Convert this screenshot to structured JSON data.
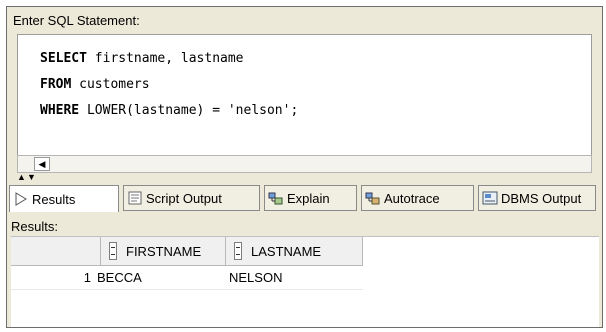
{
  "prompt_label": "Enter SQL Statement:",
  "sql": {
    "line1": {
      "keyword": "SELECT",
      "rest": " firstname, lastname"
    },
    "line2": {
      "keyword": "FROM",
      "rest": " customers"
    },
    "line3": {
      "keyword": "WHERE",
      "rest": " LOWER(lastname) = 'nelson';"
    }
  },
  "tabs": [
    {
      "label": "Results",
      "icon": "play-arrow-icon",
      "active": true
    },
    {
      "label": "Script Output",
      "icon": "script-document-icon"
    },
    {
      "label": "Explain",
      "icon": "explain-plan-icon"
    },
    {
      "label": "Autotrace",
      "icon": "autotrace-icon"
    },
    {
      "label": "DBMS Output",
      "icon": "dbms-output-icon"
    }
  ],
  "results_label": "Results:",
  "grid": {
    "columns": [
      "FIRSTNAME",
      "LASTNAME"
    ],
    "rows": [
      {
        "num": "1",
        "firstname": "BECCA",
        "lastname": "NELSON"
      }
    ]
  },
  "colors": {
    "panel": "#ece9d8",
    "border": "#6d6d6d"
  }
}
